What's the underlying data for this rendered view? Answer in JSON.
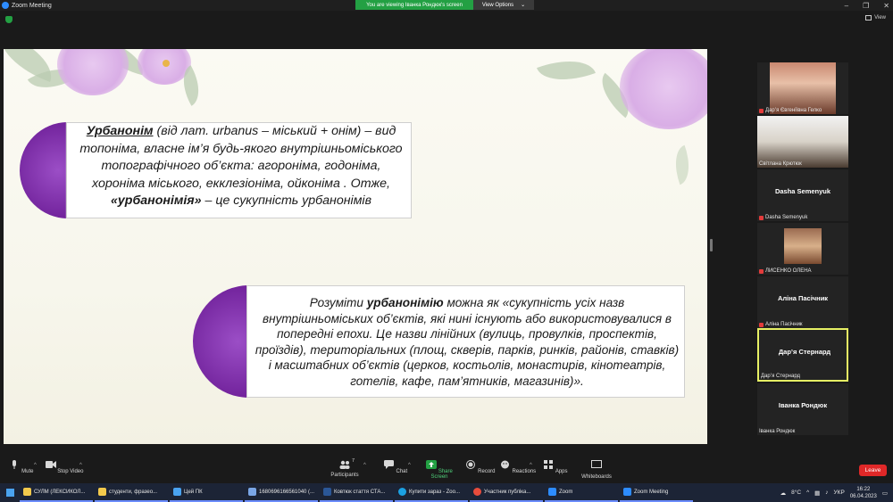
{
  "window": {
    "title": "Zoom Meeting",
    "banner": "You are viewing Іванка Рондюк's screen",
    "view_options": "View Options",
    "view_button": "View",
    "controls": [
      "–",
      "❐",
      "✕"
    ]
  },
  "slide": {
    "box1_term": "Урбанонім",
    "box1_rest": " (від лат. urbanus – міський + онім) – вид топоніма, власне ім’я будь-якого внутрішньоміського топографічного об’єкта: агороніма, годоніма, хороніма міського, екклезіоніма, ойконіма . Отже, ",
    "box1_term2": "«урбанонімія»",
    "box1_end": " – це сукупність урбанонімів",
    "box2_start": "Розуміти ",
    "box2_term": "урбанонімію",
    "box2_rest": " можна  як «сукупність усіх назв внутрішньоміських об’єктів, які нині існують або використовувалися в попередні епохи. Це назви лінійних (вулиць, провулків, проспектів, проїздів), територіальних (площ, скверів, парків, ринків, районів, ставків) і масштабних об’єктів (церков, костьолів, монастирів, кінотеатрів, готелів, кафе, пам’ятників, магазинів)»."
  },
  "participants": [
    {
      "name": "Дар’я Євгеніївна Гелко",
      "muted": true,
      "video": true
    },
    {
      "name": "Світлана Крютюк",
      "muted": false,
      "video": true
    },
    {
      "name": "Dasha Semenyuk",
      "muted": true,
      "video": false
    },
    {
      "name": "ЛИСЕНКО ОЛЕНА",
      "muted": true,
      "video": true
    },
    {
      "name": "Аліна Пасічник",
      "muted": true,
      "video": false
    },
    {
      "name": "Дар’я Стернард",
      "muted": false,
      "video": false,
      "active": true
    },
    {
      "name": "Іванка Рондюк",
      "muted": false,
      "video": false
    }
  ],
  "toolbar": {
    "mute": "Mute",
    "stop_video": "Stop Video",
    "participants": "Participants",
    "participants_count": "7",
    "chat": "Chat",
    "share_screen": "Share Screen",
    "record": "Record",
    "reactions": "Reactions",
    "apps": "Apps",
    "whiteboards": "Whiteboards",
    "leave": "Leave"
  },
  "taskbar": {
    "items": [
      {
        "label": "СУЛМ (ЛЕКСИКОЛ...",
        "color": "#f2c94c"
      },
      {
        "label": "студенти, фразео...",
        "color": "#f2c94c"
      },
      {
        "label": "Цей ПК",
        "color": "#4aa3f0"
      },
      {
        "label": "1680696166561040 (...",
        "color": "#7aa6e6"
      },
      {
        "label": "Ковтюк стаття СТА...",
        "color": "#2b5797"
      },
      {
        "label": "Купити зараз - Zoo...",
        "color": "#1ba1e2"
      },
      {
        "label": "Участник публіка...",
        "color": "#e74c3c"
      },
      {
        "label": "Zoom",
        "color": "#2d8cff"
      },
      {
        "label": "Zoom Meeting",
        "color": "#2d8cff"
      }
    ],
    "weather": "8°C",
    "lang": "УКР",
    "time": "16:22",
    "date": "06.04.2023"
  },
  "colors": {
    "accent_purple": "#6e1f98",
    "zoom_blue": "#2d8cff",
    "banner_green": "#23a043",
    "leave_red": "#e02828"
  }
}
